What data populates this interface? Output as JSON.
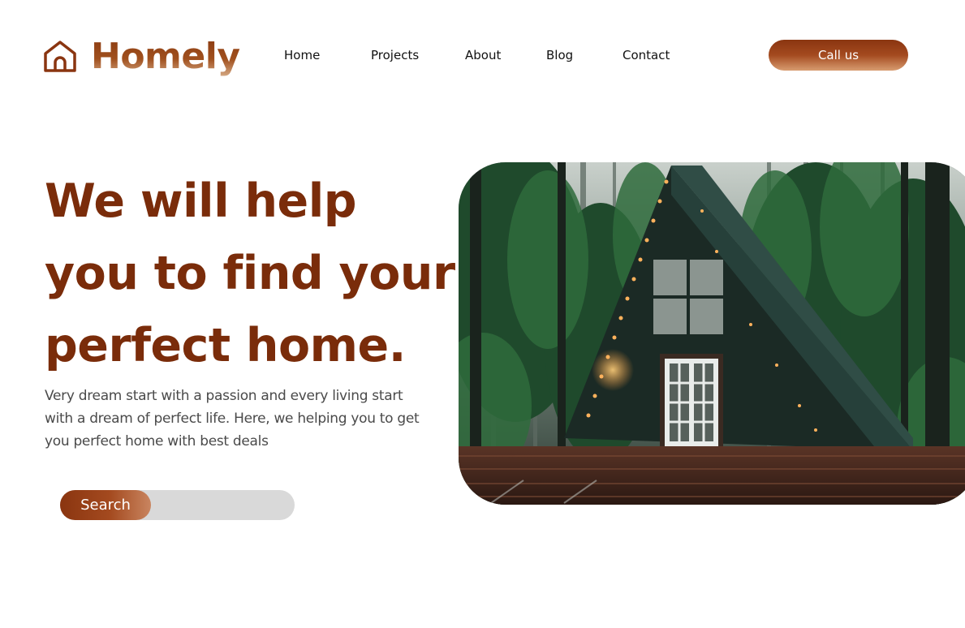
{
  "brand": {
    "name": "Homely",
    "icon": "house-icon"
  },
  "nav": {
    "links": [
      "Home",
      "Projects",
      "About",
      "Blog",
      "Contact"
    ],
    "cta_label": "Call us"
  },
  "hero": {
    "title_lines": [
      "We will help",
      "you to find your",
      "perfect home."
    ],
    "description": "Very dream start with a passion and every living start with a dream of perfect life. Here, we helping you to get you perfect home with best deals",
    "search_label": "Search",
    "image": "a-frame-cabin-in-forest-photo"
  },
  "colors": {
    "brand_brown": "#7a2c0a",
    "button_gradient_start": "#8a3510",
    "button_gradient_end": "#d89c70",
    "search_track": "#d9d9d9"
  }
}
